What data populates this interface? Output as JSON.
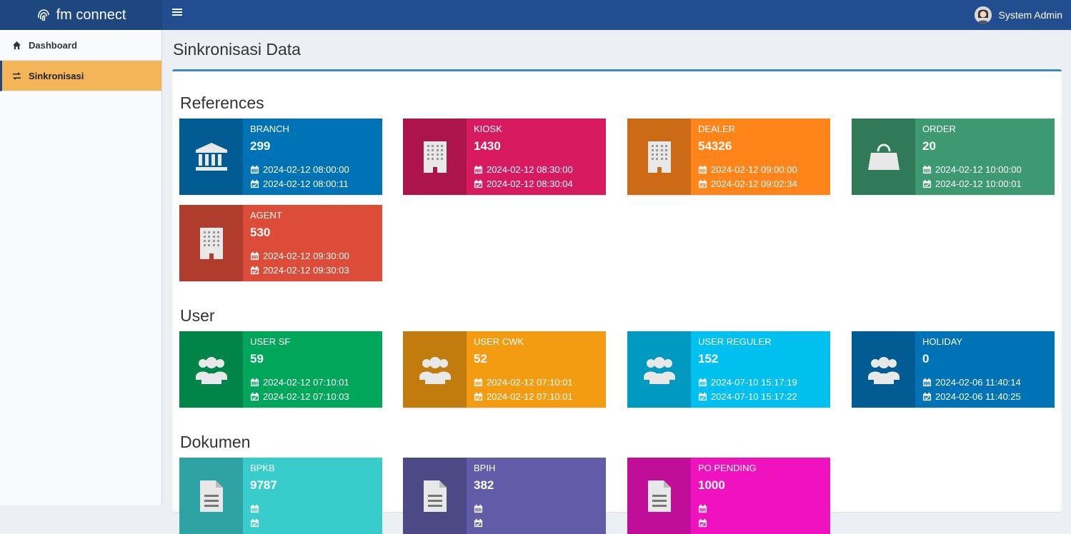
{
  "app": {
    "logo_text": "fm connect"
  },
  "header": {
    "user_name": "System Admin"
  },
  "sidebar": {
    "items": [
      {
        "label": "Dashboard",
        "icon": "home-icon",
        "active": false
      },
      {
        "label": "Sinkronisasi",
        "icon": "exchange-icon",
        "active": true
      }
    ]
  },
  "page": {
    "title": "Sinkronisasi Data"
  },
  "sections": [
    {
      "title": "References",
      "cards": [
        {
          "label": "BRANCH",
          "count": "299",
          "start": "2024-02-12 08:00:00",
          "end": "2024-02-12 08:00:11",
          "color": "#0073b7",
          "icon": "bank-icon"
        },
        {
          "label": "KIOSK",
          "count": "1430",
          "start": "2024-02-12 08:30:00",
          "end": "2024-02-12 08:30:04",
          "color": "#d81b60",
          "icon": "building-icon"
        },
        {
          "label": "DEALER",
          "count": "54326",
          "start": "2024-02-12 09:00:00",
          "end": "2024-02-12 09:02:34",
          "color": "#ff851b",
          "icon": "building-icon"
        },
        {
          "label": "ORDER",
          "count": "20",
          "start": "2024-02-12 10:00:00",
          "end": "2024-02-12 10:00:01",
          "color": "#3d9970",
          "icon": "shopping-bag-icon"
        },
        {
          "label": "AGENT",
          "count": "530",
          "start": "2024-02-12 09:30:00",
          "end": "2024-02-12 09:30:03",
          "color": "#dd4b39",
          "icon": "building-icon"
        }
      ]
    },
    {
      "title": "User",
      "cards": [
        {
          "label": "USER SF",
          "count": "59",
          "start": "2024-02-12 07:10:01",
          "end": "2024-02-12 07:10:03",
          "color": "#00a65a",
          "icon": "users-icon"
        },
        {
          "label": "USER CWK",
          "count": "52",
          "start": "2024-02-12 07:10:01",
          "end": "2024-02-12 07:10:01",
          "color": "#f39c12",
          "icon": "users-icon"
        },
        {
          "label": "USER REGULER",
          "count": "152",
          "start": "2024-07-10 15:17:19",
          "end": "2024-07-10 15:17:22",
          "color": "#00c0ef",
          "icon": "users-icon"
        },
        {
          "label": "HOLIDAY",
          "count": "0",
          "start": "2024-02-06 11:40:14",
          "end": "2024-02-06 11:40:25",
          "color": "#0073b7",
          "icon": "users-icon"
        }
      ]
    },
    {
      "title": "Dokumen",
      "cards": [
        {
          "label": "BPKB",
          "count": "9787",
          "start": "",
          "end": "",
          "color": "#39cccc",
          "icon": "file-icon"
        },
        {
          "label": "BPIH",
          "count": "382",
          "start": "",
          "end": "",
          "color": "#605ca8",
          "icon": "file-icon"
        },
        {
          "label": "PO PENDING",
          "count": "1000",
          "start": "",
          "end": "",
          "color": "#f012be",
          "icon": "file-icon"
        }
      ]
    }
  ]
}
